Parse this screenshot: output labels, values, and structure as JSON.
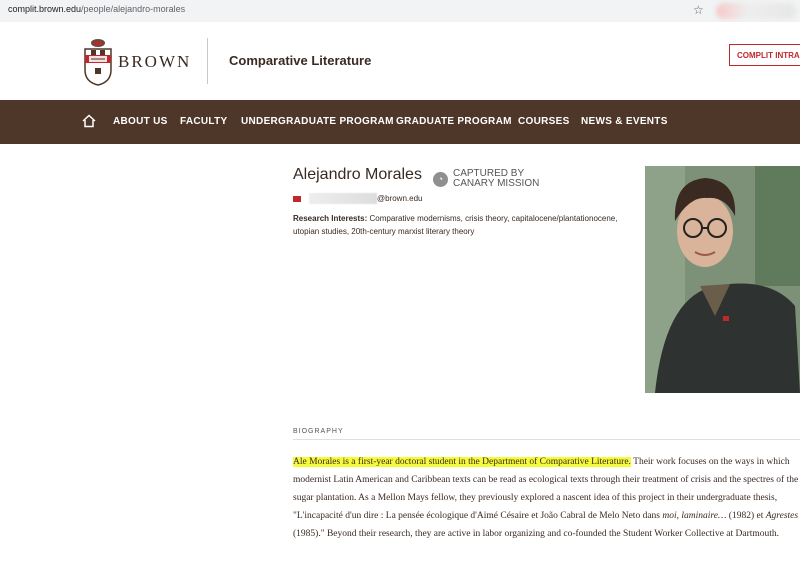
{
  "browser": {
    "url_host": "complit.brown.edu",
    "url_path": "/people/alejandro-morales"
  },
  "header": {
    "logo_text": "BROWN",
    "department": "Comparative Literature",
    "intranet_button": "COMPLIT INTRAN"
  },
  "nav": {
    "items": [
      "ABOUT US",
      "FACULTY",
      "UNDERGRADUATE PROGRAM",
      "GRADUATE PROGRAM",
      "COURSES",
      "NEWS & EVENTS"
    ]
  },
  "profile": {
    "name": "Alejandro Morales",
    "captured_line1": "CAPTURED BY",
    "captured_line2": "CANARY MISSION",
    "email_domain": "@brown.edu",
    "interests_label": "Research Interests:",
    "interests": "Comparative modernisms, crisis theory, capitalocene/plantationocene, utopian studies, 20th-century marxist literary theory"
  },
  "biography": {
    "label": "BIOGRAPHY",
    "highlighted": "Ale Morales is a first-year doctoral student in the Department of Comparative Literature.",
    "part1": " Their work focuses on the ways in which modernist Latin American and Caribbean texts can be read as ecological texts through their treatment of crisis and the spectres of the sugar plantation. As a Mellon Mays fellow, they previously explored a nascent idea of this project in their undergraduate thesis, \"L'incapacité d'un dire : La pensée écologique d'Aimé Césaire et João Cabral de Melo Neto dans ",
    "italic1": "moi, laminaire…",
    "part2": " (1982) et ",
    "italic2": "Agrestes",
    "part3": " (1985).\" Beyond their research, they are active in labor organizing and co-founded the Student Worker Collective at Dartmouth."
  },
  "colors": {
    "nav_bg": "#4e3629",
    "brand_red": "#c0282d",
    "highlight": "#f3fb3a"
  }
}
